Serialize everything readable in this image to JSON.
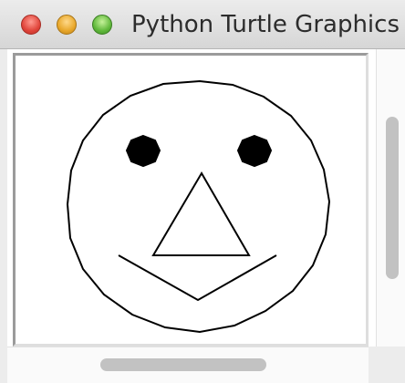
{
  "window": {
    "title": "Python Turtle Graphics",
    "buttons": {
      "close": "close-icon",
      "minimize": "minimize-icon",
      "maximize": "maximize-icon"
    }
  },
  "canvas": {
    "drawing": "smiley-face",
    "stroke_color": "#000000",
    "fill_color": "#000000"
  }
}
